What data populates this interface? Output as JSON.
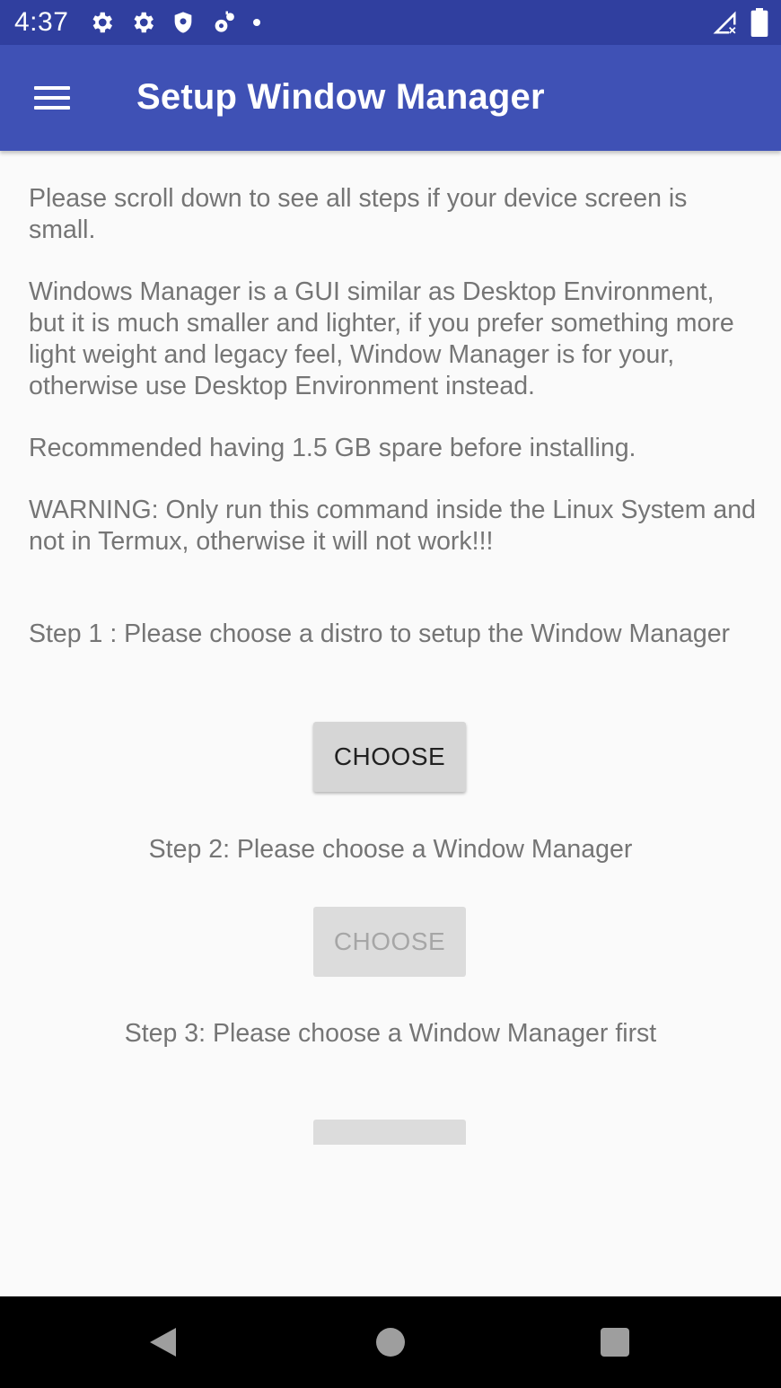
{
  "status_bar": {
    "time": "4:37",
    "left_icons": [
      "settings-icon",
      "settings-icon",
      "shield-icon",
      "settings-alert-icon",
      "dot-icon"
    ],
    "right_icons": [
      "signal-icon",
      "battery-icon"
    ]
  },
  "app_bar": {
    "title": "Setup Window Manager",
    "menu_icon": "hamburger-menu-icon",
    "color": "#3f51b5"
  },
  "content": {
    "paragraphs": [
      "Please scroll down to see all steps if your device screen is small.",
      "Windows Manager is a GUI similar as Desktop Environment, but it is much smaller and lighter, if you prefer something more light weight and legacy feel, Window Manager is for your, otherwise use Desktop Environment instead.",
      "Recommended having 1.5 GB spare before installing.",
      "WARNING: Only run this command inside the Linux System and not in Termux, otherwise it will not work!!!"
    ],
    "steps": [
      {
        "label": "Step 1 : Please choose a distro to setup the Window Manager",
        "button": "CHOOSE",
        "enabled": true
      },
      {
        "label": "Step 2: Please choose a Window Manager",
        "button": "CHOOSE",
        "enabled": false
      },
      {
        "label": "Step 3: Please choose a Window Manager first",
        "button": "",
        "enabled": false
      }
    ]
  },
  "nav_bar": {
    "icons": [
      "back-icon",
      "home-icon",
      "recents-icon"
    ]
  }
}
